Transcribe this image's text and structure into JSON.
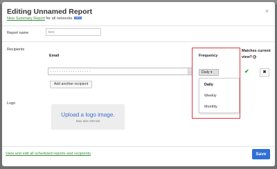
{
  "modal": {
    "title": "Editing Unnamed Report",
    "subtitle_link": "New Summary Report",
    "subtitle_rest": " for all networks",
    "new_badge": "NEW",
    "close_label": "×"
  },
  "report_name": {
    "label": "Report name",
    "value": "test"
  },
  "recipients": {
    "label": "Recipients",
    "email_header": "Email",
    "frequency_header": "Frequency",
    "matches_header": "Matches current view?",
    "help_icon": "?",
    "email_value": "··················",
    "email_button_glyph": "…",
    "frequency_selected": "Daily ▾",
    "frequency_options": [
      "Daily",
      "Weekly",
      "Monthly"
    ],
    "matches_glyph": "✔",
    "remove_glyph": "✖",
    "add_another_label": "Add another recipient"
  },
  "logo": {
    "label": "Logo",
    "upload_text": "Upload a logo image.",
    "max_size_text": "Max size 200 KB"
  },
  "footer": {
    "link_text": "View and edit all scheduled reports and recipients",
    "save_label": "Save"
  },
  "colors": {
    "accent": "#2f6fd6",
    "link_green": "#3b8a3b",
    "highlight_red": "#d9363e",
    "check_green": "#2e9b2e"
  }
}
